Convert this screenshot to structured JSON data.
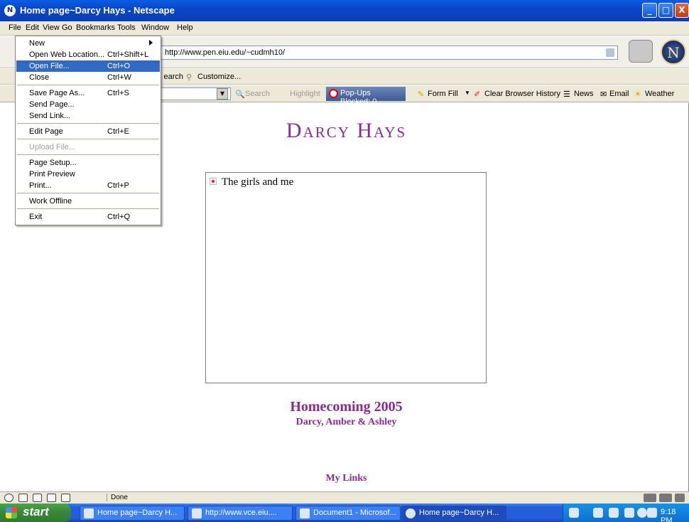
{
  "window": {
    "title": "Home page~Darcy Hays - Netscape",
    "app_icon": "netscape-icon",
    "controls": {
      "minimize": "_",
      "maximize": "□",
      "close": "X"
    }
  },
  "menubar": [
    "File",
    "Edit",
    "View",
    "Go",
    "Bookmarks",
    "Tools",
    "Window",
    "Help"
  ],
  "file_menu": [
    {
      "label": "New",
      "shortcut": "",
      "submenu": true
    },
    {
      "label": "Open Web Location...",
      "shortcut": "Ctrl+Shift+L"
    },
    {
      "label": "Open File...",
      "shortcut": "Ctrl+O",
      "highlighted": true
    },
    {
      "label": "Close",
      "shortcut": "Ctrl+W"
    },
    {
      "label": "Save Page As...",
      "shortcut": "Ctrl+S"
    },
    {
      "label": "Send Page...",
      "shortcut": ""
    },
    {
      "label": "Send Link...",
      "shortcut": ""
    },
    {
      "label": "Edit Page",
      "shortcut": "Ctrl+E"
    },
    {
      "label": "Upload File...",
      "shortcut": "",
      "disabled": true
    },
    {
      "label": "Page Setup...",
      "shortcut": ""
    },
    {
      "label": "Print Preview",
      "shortcut": ""
    },
    {
      "label": "Print...",
      "shortcut": "Ctrl+P"
    },
    {
      "label": "Work Offline",
      "shortcut": ""
    },
    {
      "label": "Exit",
      "shortcut": "Ctrl+Q"
    }
  ],
  "address_bar": {
    "url": "http://www.pen.eiu.edu/~cudmh10/"
  },
  "personal_toolbar": {
    "search_fragment": "earch",
    "customize": "Customize..."
  },
  "search_toolbar": {
    "search": "Search",
    "highlight": "Highlight",
    "popups_blocked": "Pop-Ups Blocked: 0",
    "form_fill": "Form Fill",
    "clear_history": "Clear Browser History",
    "news": "News",
    "email": "Email",
    "weather": "Weather"
  },
  "page": {
    "site_title": "Darcy Hays",
    "image_alt": "The girls and me",
    "heading": "Homecoming 2005",
    "subheading": "Darcy, Amber & Ashley",
    "links_heading": "My Links",
    "accent_color": "#8b2a94"
  },
  "status": {
    "text": "Done"
  },
  "taskbar": {
    "start_label": "start",
    "tasks": [
      {
        "label": "Home page~Darcy H...",
        "active": false
      },
      {
        "label": "http://www.vce.eiu....",
        "active": false
      },
      {
        "label": "Document1 - Microsof...",
        "active": false
      },
      {
        "label": "Home page~Darcy H...",
        "active": true
      }
    ],
    "clock": "9:18 PM"
  }
}
